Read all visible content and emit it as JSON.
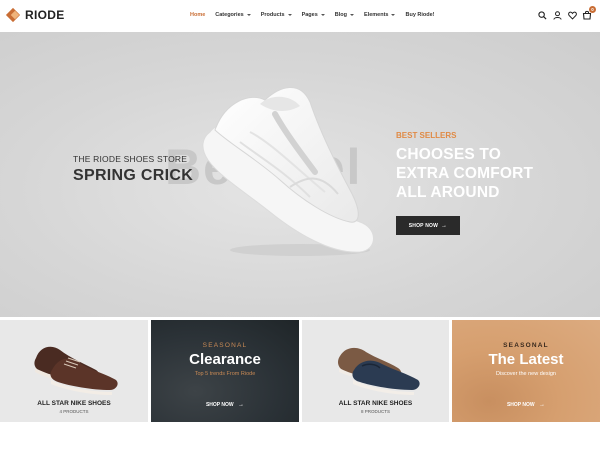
{
  "brand": {
    "name": "RIODE"
  },
  "nav": {
    "items": [
      {
        "label": "Home",
        "active": true,
        "dropdown": false
      },
      {
        "label": "Categories",
        "active": false,
        "dropdown": true
      },
      {
        "label": "Products",
        "active": false,
        "dropdown": true
      },
      {
        "label": "Pages",
        "active": false,
        "dropdown": true
      },
      {
        "label": "Blog",
        "active": false,
        "dropdown": true
      },
      {
        "label": "Elements",
        "active": false,
        "dropdown": true
      },
      {
        "label": "Buy Riode!",
        "active": false,
        "dropdown": false
      }
    ]
  },
  "header_icons": [
    "search-icon",
    "user-icon",
    "heart-icon",
    "cart-icon"
  ],
  "cart": {
    "count": "0"
  },
  "hero": {
    "watermark": "BestSel",
    "subtitle": "THE RIODE SHOES STORE",
    "title": "SPRING CRICK",
    "kicker": "BEST SELLERS",
    "lines": [
      "CHOOSES TO",
      "EXTRA COMFORT",
      "ALL AROUND"
    ],
    "button_label": "SHOP NOW"
  },
  "banners": [
    {
      "type": "product",
      "title": "ALL STAR NIKE SHOES",
      "count": "4 PRODUCTS"
    },
    {
      "type": "promo",
      "kicker": "SEASONAL",
      "title": "Clearance",
      "subtitle": "Top 5 trends From Riode",
      "link": "SHOP NOW"
    },
    {
      "type": "product",
      "title": "ALL STAR NIKE SHOES",
      "count": "8 PRODUCTS"
    },
    {
      "type": "promo",
      "kicker": "SEASONAL",
      "title": "The Latest",
      "subtitle": "Discover the new design",
      "link": "SHOP NOW"
    }
  ],
  "colors": {
    "accent": "#c96d34",
    "hero_kicker": "#e08a45",
    "dark_button": "#2a2a2a",
    "clearance_bg": "#2b3237",
    "latest_bg": "#d69f6f"
  }
}
